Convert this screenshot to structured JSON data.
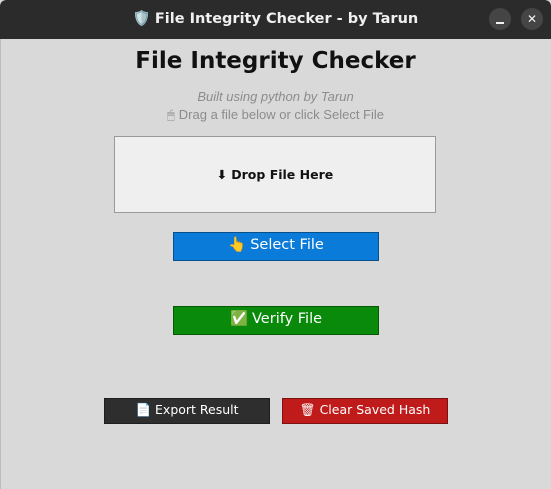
{
  "window": {
    "title_icon": "🛡️",
    "title": "File Integrity Checker - by Tarun",
    "minimize_icon": "minimize-icon",
    "close_glyph": "✕"
  },
  "header": {
    "title": "File Integrity Checker",
    "subtitle": "Built using python by Tarun",
    "hint_icon": "🖱",
    "hint": "Drag a file below or click Select File"
  },
  "drop_zone": {
    "icon": "⬇",
    "label": "Drop File Here"
  },
  "buttons": {
    "select": {
      "icon": "👆",
      "label": "Select File",
      "color": "#0a7bd8"
    },
    "verify": {
      "icon": "✅",
      "label": "Verify File",
      "color": "#0a8a0a"
    },
    "export": {
      "icon": "📄",
      "label": "Export Result",
      "color": "#2e2e2e"
    },
    "clear": {
      "icon": "🗑",
      "label": "Clear Saved Hash",
      "color": "#bf1b1b"
    }
  }
}
